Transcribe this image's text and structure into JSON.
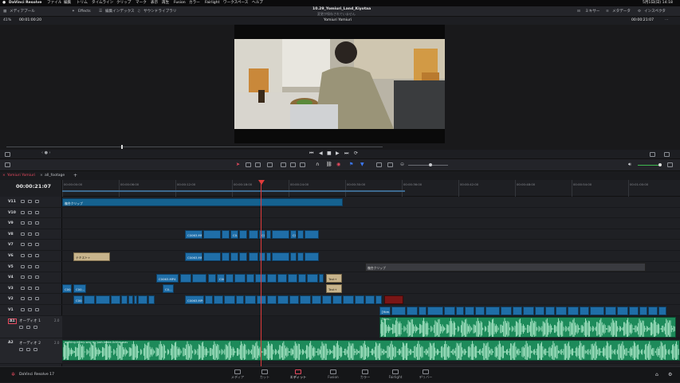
{
  "menubar": {
    "app_name": "DaVinci Resolve",
    "items": [
      "ファイル",
      "編集",
      "トリム",
      "タイムライン",
      "クリップ",
      "マーク",
      "表示",
      "再生",
      "Fusion",
      "カラー",
      "Fairlight",
      "ワークスペース",
      "ヘルプ"
    ],
    "clock": "5月1日(日) 14:18"
  },
  "toolbar": {
    "media_pool": "メディアプール",
    "effects": "Effects",
    "edit_index": "編集インデックス",
    "sound_library": "サウンドライブラリ",
    "project_title": "10.29_Yomiuri_Land_Kiyotaa",
    "status": "変更が保存されていません",
    "mixer": "ミキサー",
    "metadata": "メタデータ",
    "inspector": "インスペクタ"
  },
  "viewer": {
    "zoom": "41%",
    "source_timecode": "00:01:00:20",
    "timeline_name": "Yomiuri Yomiuri",
    "record_timecode": "00:00:21:07"
  },
  "timeline": {
    "tabs": [
      "Yomiuri Yomiuri",
      "all_footage"
    ],
    "timecode": "00:00:21:07",
    "ruler_ticks": [
      "00:00:00:00",
      "00:00:06:00",
      "00:00:12:00",
      "00:00:18:00",
      "00:00:24:00",
      "00:00:30:00",
      "00:00:36:00",
      "00:00:42:00",
      "00:00:48:00",
      "00:00:54:00",
      "00:01:00:00",
      "00:01:06:00"
    ],
    "video_tracks": [
      "V11",
      "V10",
      "V9",
      "V8",
      "V7",
      "V6",
      "V5",
      "V4",
      "V3",
      "V2",
      "V1"
    ],
    "audio_tracks": [
      {
        "id": "A1",
        "name": "オーディオ 1",
        "level": "2.0"
      },
      {
        "id": "A2",
        "name": "オーディオ 2",
        "level": "2.0"
      }
    ],
    "compound_label": "複合クリップ",
    "clip_prefix": "C0063.MP4",
    "short_clip": "C00...",
    "mid_clip": "C006...",
    "tiny_clip": "C0...",
    "title_clip": "テキスト+",
    "tan_clip": "Text+",
    "audio_clip_a1": "[Yom...",
    "audio_clip_a2": "walking-in-my-way by josh-leake-lichter.wav"
  },
  "pages": [
    "メディア",
    "カット",
    "エディット",
    "Fusion",
    "カラー",
    "Fairlight",
    "デリバー"
  ],
  "active_page": "エディット",
  "footer_app": "DaVinci Resolve 17",
  "colors": {
    "accent": "#e84a5f",
    "video_clip": "#1f6ea8",
    "audio_clip": "#1d8a5a",
    "playhead": "#e23b3b"
  }
}
